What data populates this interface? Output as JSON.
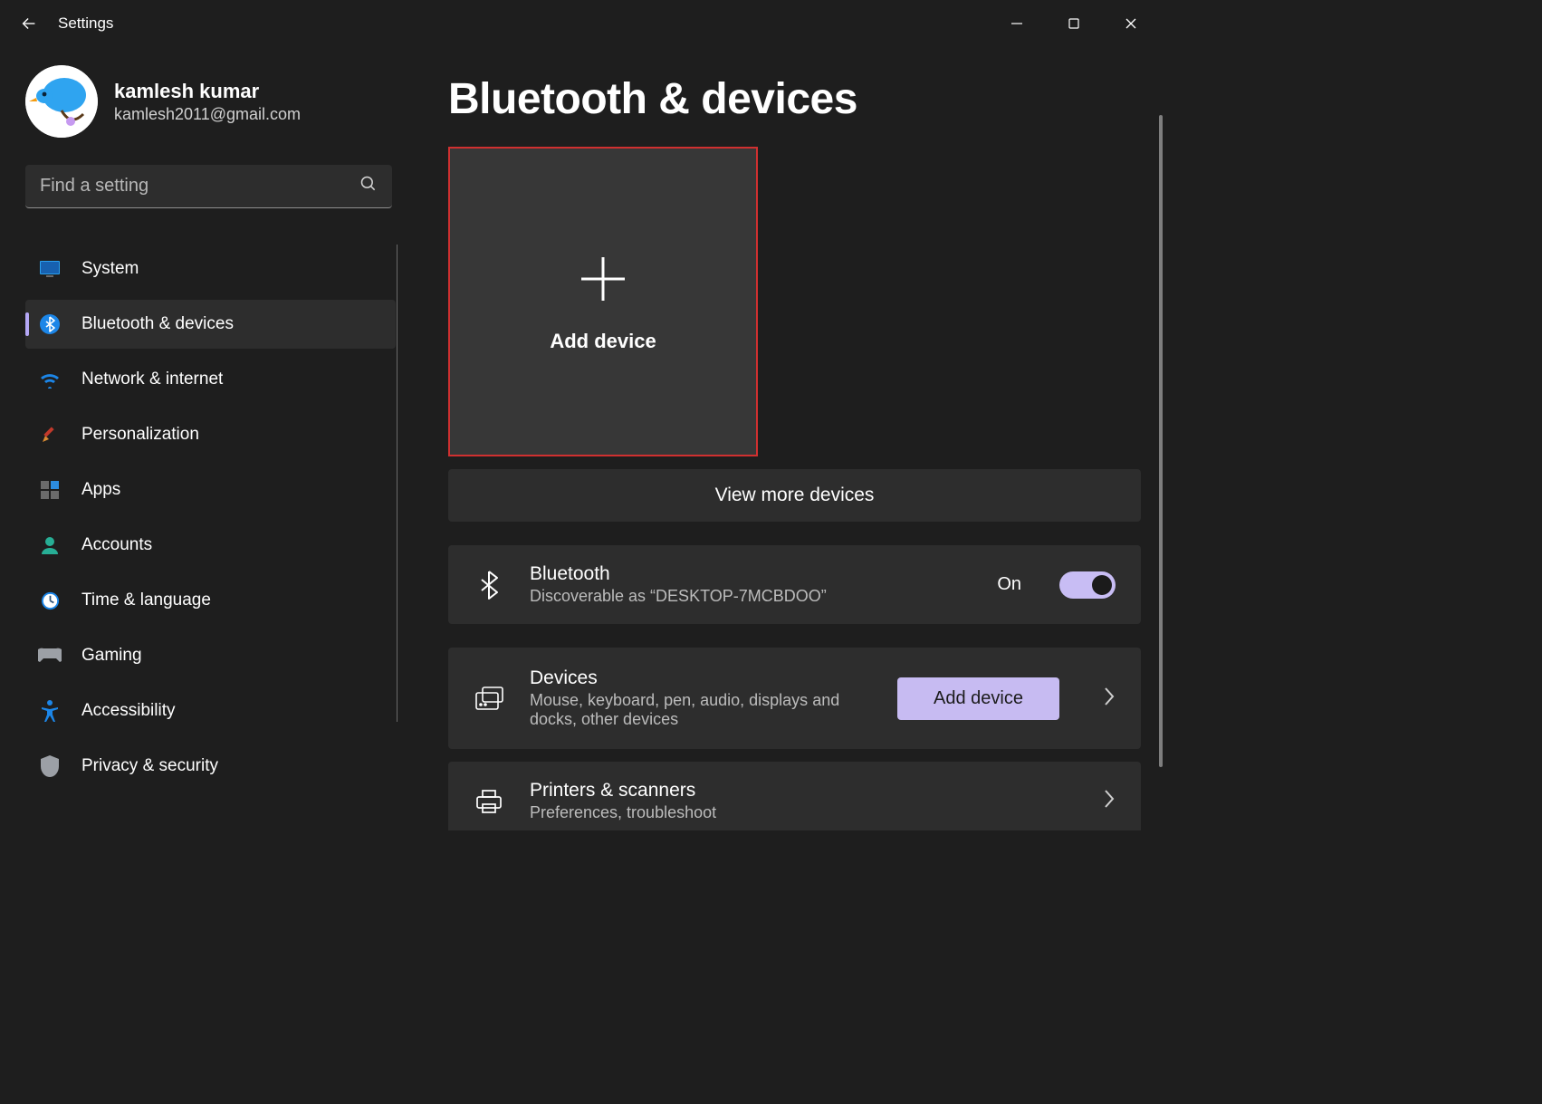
{
  "app_title": "Settings",
  "user": {
    "name": "kamlesh kumar",
    "email": "kamlesh2011@gmail.com"
  },
  "search": {
    "placeholder": "Find a setting"
  },
  "nav": [
    {
      "label": "System"
    },
    {
      "label": "Bluetooth & devices"
    },
    {
      "label": "Network & internet"
    },
    {
      "label": "Personalization"
    },
    {
      "label": "Apps"
    },
    {
      "label": "Accounts"
    },
    {
      "label": "Time & language"
    },
    {
      "label": "Gaming"
    },
    {
      "label": "Accessibility"
    },
    {
      "label": "Privacy & security"
    }
  ],
  "page": {
    "title": "Bluetooth & devices",
    "add_device_label": "Add device",
    "view_more": "View more devices",
    "bluetooth": {
      "title": "Bluetooth",
      "sub": "Discoverable as “DESKTOP-7MCBDOO”",
      "state_label": "On"
    },
    "devices": {
      "title": "Devices",
      "sub": "Mouse, keyboard, pen, audio, displays and docks, other devices",
      "button": "Add device"
    },
    "printers": {
      "title": "Printers & scanners",
      "sub": "Preferences, troubleshoot"
    }
  }
}
